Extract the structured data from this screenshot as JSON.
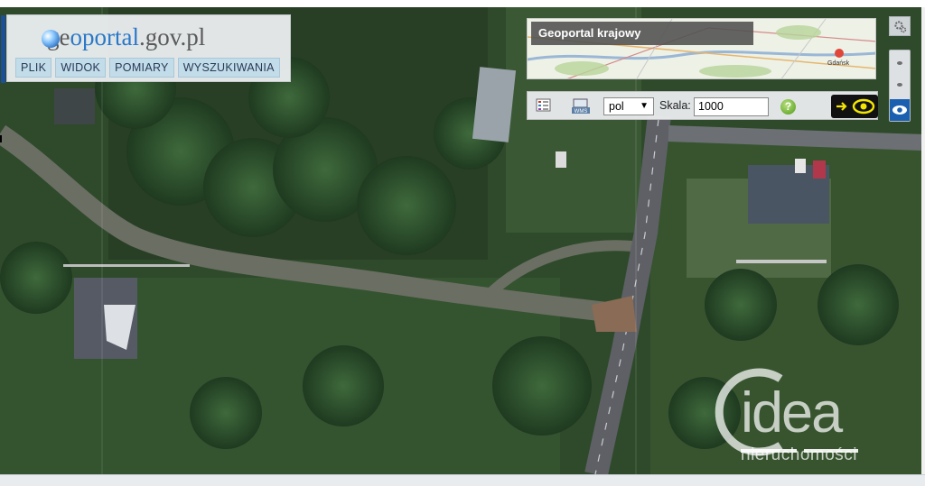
{
  "logo": {
    "part1": "ge",
    "part2": "oportal",
    "part3": ".gov.pl"
  },
  "menu": [
    {
      "label": "PLIK"
    },
    {
      "label": "WIDOK"
    },
    {
      "label": "POMIARY"
    },
    {
      "label": "WYSZUKIWANIA"
    }
  ],
  "overview": {
    "title": "Geoportal krajowy",
    "map_label": "Gdańsk"
  },
  "toolbar": {
    "language": "pol",
    "scale_label": "Skala:",
    "scale_value": "1000",
    "help_label": "?"
  },
  "watermark": {
    "main": "idea",
    "sub": "nieruchomości"
  },
  "icons": {
    "legend": "legend-icon",
    "wms": "wms-icon",
    "arrow": "arrow-right-icon",
    "eye": "eye-icon",
    "gear": "gear-icon"
  },
  "colors": {
    "menu_bg": "#c2dce9",
    "brand_blue": "#1b4f9c",
    "eye_yellow": "#f2e600",
    "side_blue": "#1b5fb0"
  }
}
